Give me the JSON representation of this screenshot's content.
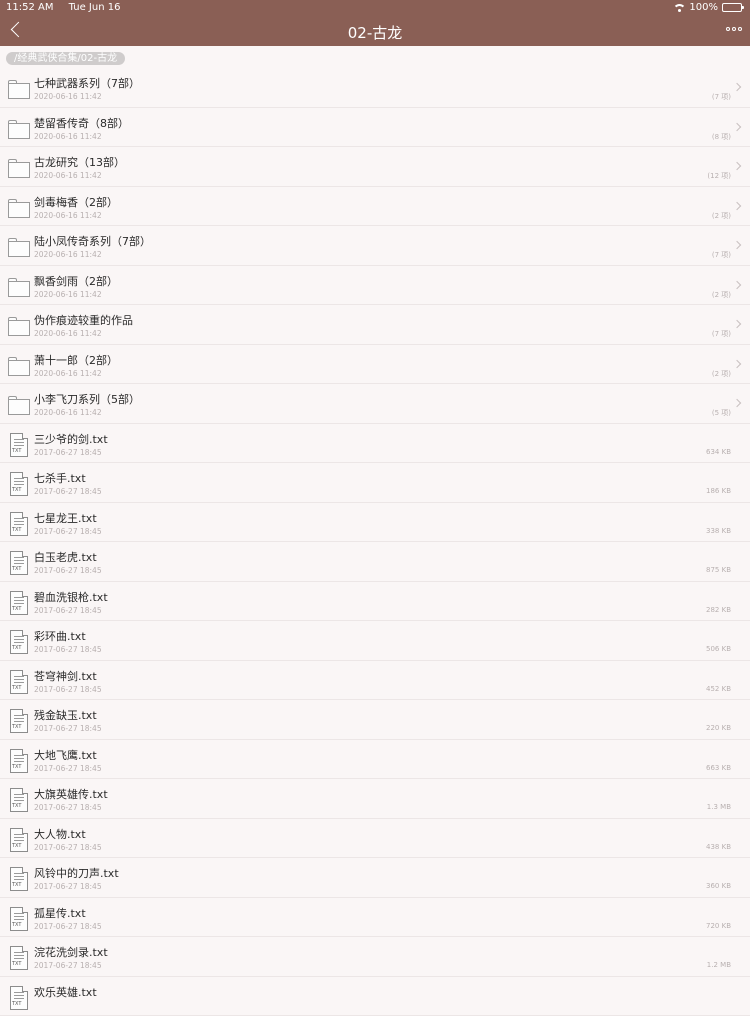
{
  "status_bar": {
    "time": "11:52 AM",
    "date": "Tue Jun 16",
    "battery": "100%"
  },
  "nav": {
    "title": "02-古龙"
  },
  "breadcrumb": "/经典武侠合集/02-古龙",
  "folders": [
    {
      "name": "七种武器系列（7部）",
      "date": "2020-06-16 11:42",
      "count": "(7 项)"
    },
    {
      "name": "楚留香传奇（8部）",
      "date": "2020-06-16 11:42",
      "count": "(8 项)"
    },
    {
      "name": "古龙研究（13部）",
      "date": "2020-06-16 11:42",
      "count": "(12 项)"
    },
    {
      "name": "剑毒梅香（2部）",
      "date": "2020-06-16 11:42",
      "count": "(2 项)"
    },
    {
      "name": "陆小凤传奇系列（7部）",
      "date": "2020-06-16 11:42",
      "count": "(7 项)"
    },
    {
      "name": "飘香剑雨（2部）",
      "date": "2020-06-16 11:42",
      "count": "(2 项)"
    },
    {
      "name": "伪作痕迹较重的作品",
      "date": "2020-06-16 11:42",
      "count": "(7 项)"
    },
    {
      "name": "萧十一郎（2部）",
      "date": "2020-06-16 11:42",
      "count": "(2 项)"
    },
    {
      "name": "小李飞刀系列（5部）",
      "date": "2020-06-16 11:42",
      "count": "(5 项)"
    }
  ],
  "files": [
    {
      "name": "三少爷的剑.txt",
      "date": "2017-06-27 18:45",
      "size": "634 KB"
    },
    {
      "name": "七杀手.txt",
      "date": "2017-06-27 18:45",
      "size": "186 KB"
    },
    {
      "name": "七星龙王.txt",
      "date": "2017-06-27 18:45",
      "size": "338 KB"
    },
    {
      "name": "白玉老虎.txt",
      "date": "2017-06-27 18:45",
      "size": "875 KB"
    },
    {
      "name": "碧血洗银枪.txt",
      "date": "2017-06-27 18:45",
      "size": "282 KB"
    },
    {
      "name": "彩环曲.txt",
      "date": "2017-06-27 18:45",
      "size": "506 KB"
    },
    {
      "name": "苍穹神剑.txt",
      "date": "2017-06-27 18:45",
      "size": "452 KB"
    },
    {
      "name": "残金缺玉.txt",
      "date": "2017-06-27 18:45",
      "size": "220 KB"
    },
    {
      "name": "大地飞鹰.txt",
      "date": "2017-06-27 18:45",
      "size": "663 KB"
    },
    {
      "name": "大旗英雄传.txt",
      "date": "2017-06-27 18:45",
      "size": "1.3 MB"
    },
    {
      "name": "大人物.txt",
      "date": "2017-06-27 18:45",
      "size": "438 KB"
    },
    {
      "name": "风铃中的刀声.txt",
      "date": "2017-06-27 18:45",
      "size": "360 KB"
    },
    {
      "name": "孤星传.txt",
      "date": "2017-06-27 18:45",
      "size": "720 KB"
    },
    {
      "name": "浣花洗剑录.txt",
      "date": "2017-06-27 18:45",
      "size": "1.2 MB"
    },
    {
      "name": "欢乐英雄.txt",
      "date": "",
      "size": ""
    }
  ],
  "icons": {
    "folder": "folder-icon",
    "file": "txt-file-icon",
    "back": "back-chevron-icon",
    "more": "more-icon",
    "wifi": "wifi-icon",
    "battery": "battery-icon"
  },
  "colors": {
    "nav_bar": "#8a5f55",
    "background": "#faf6f6"
  },
  "file_tag": "TXT"
}
